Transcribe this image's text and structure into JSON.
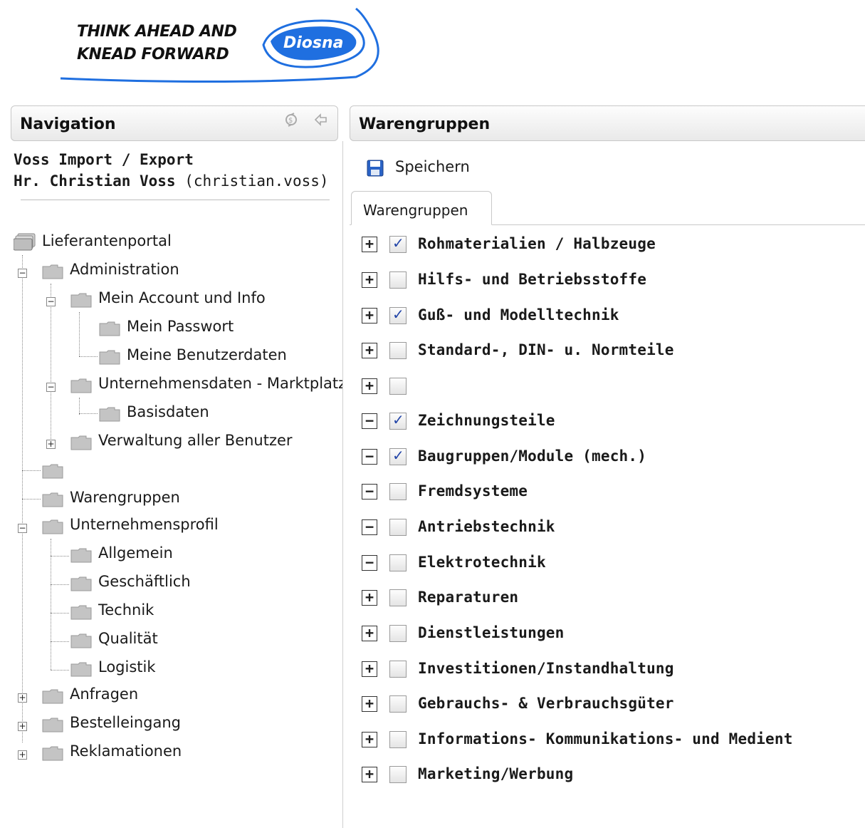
{
  "logo": {
    "tagline_line1": "THINK AHEAD AND",
    "tagline_line2": "KNEAD FORWARD",
    "brand": "Diosna",
    "accent": "#1f6fe0"
  },
  "nav": {
    "title": "Navigation",
    "icons": [
      "refresh-icon",
      "collapse-left-icon"
    ],
    "company": "Voss Import / Export",
    "user_name": "Hr. Christian Voss",
    "user_login": "(christian.voss)",
    "tree": {
      "root": "Lieferantenportal",
      "administration": "Administration",
      "mein_account": "Mein Account und Info",
      "mein_passwort": "Mein Passwort",
      "meine_benutzerdaten": "Meine Benutzerdaten",
      "unternehmensdaten": "Unternehmensdaten - Marktplatz",
      "basisdaten": "Basisdaten",
      "verwaltung": "Verwaltung aller Benutzer",
      "unnamed": "",
      "warengruppen": "Warengruppen",
      "unternehmensprofil": "Unternehmensprofil",
      "allgemein": "Allgemein",
      "geschaeftlich": "Geschäftlich",
      "technik": "Technik",
      "qualitaet": "Qualität",
      "logistik": "Logistik",
      "anfragen": "Anfragen",
      "bestelleingang": "Bestelleingang",
      "reklamationen": "Reklamationen"
    }
  },
  "main": {
    "title": "Warengruppen",
    "save_label": "Speichern",
    "tab_label": "Warengruppen",
    "categories": [
      {
        "label": "Rohmaterialien / Halbzeuge",
        "expander": "+",
        "checked": true
      },
      {
        "label": "Hilfs- und Betriebsstoffe",
        "expander": "+",
        "checked": false
      },
      {
        "label": "Guß- und Modelltechnik",
        "expander": "+",
        "checked": true
      },
      {
        "label": "Standard-, DIN- u. Normteile",
        "expander": "+",
        "checked": false
      },
      {
        "label": "",
        "expander": "+",
        "checked": false
      },
      {
        "label": "Zeichnungsteile",
        "expander": "−",
        "checked": true
      },
      {
        "label": "Baugruppen/Module (mech.)",
        "expander": "−",
        "checked": true
      },
      {
        "label": "Fremdsysteme",
        "expander": "−",
        "checked": false
      },
      {
        "label": "Antriebstechnik",
        "expander": "−",
        "checked": false
      },
      {
        "label": "Elektrotechnik",
        "expander": "−",
        "checked": false
      },
      {
        "label": "Reparaturen",
        "expander": "+",
        "checked": false
      },
      {
        "label": "Dienstleistungen",
        "expander": "+",
        "checked": false
      },
      {
        "label": "Investitionen/Instandhaltung",
        "expander": "+",
        "checked": false
      },
      {
        "label": "Gebrauchs- & Verbrauchsgüter",
        "expander": "+",
        "checked": false
      },
      {
        "label": "Informations- Kommunikations- und Medient",
        "expander": "+",
        "checked": false
      },
      {
        "label": "Marketing/Werbung",
        "expander": "+",
        "checked": false
      }
    ]
  }
}
